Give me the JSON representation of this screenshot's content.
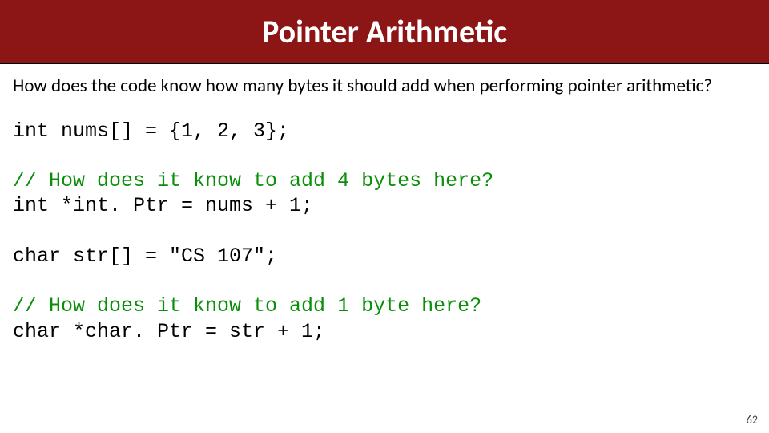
{
  "slide": {
    "title": "Pointer Arithmetic",
    "question": "How does the code know how many bytes it should add when performing pointer arithmetic?",
    "code": {
      "line1": "int nums[] = {1, 2, 3};",
      "blank1": "",
      "comment1": "// How does it know to add 4 bytes here?",
      "line2": "int *int. Ptr = nums + 1;",
      "blank2": "",
      "line3": "char str[] = \"CS 107\";",
      "blank3": "",
      "comment2": "// How does it know to add 1 byte here?",
      "line4": "char *char. Ptr = str + 1;"
    },
    "page_number": "62"
  }
}
